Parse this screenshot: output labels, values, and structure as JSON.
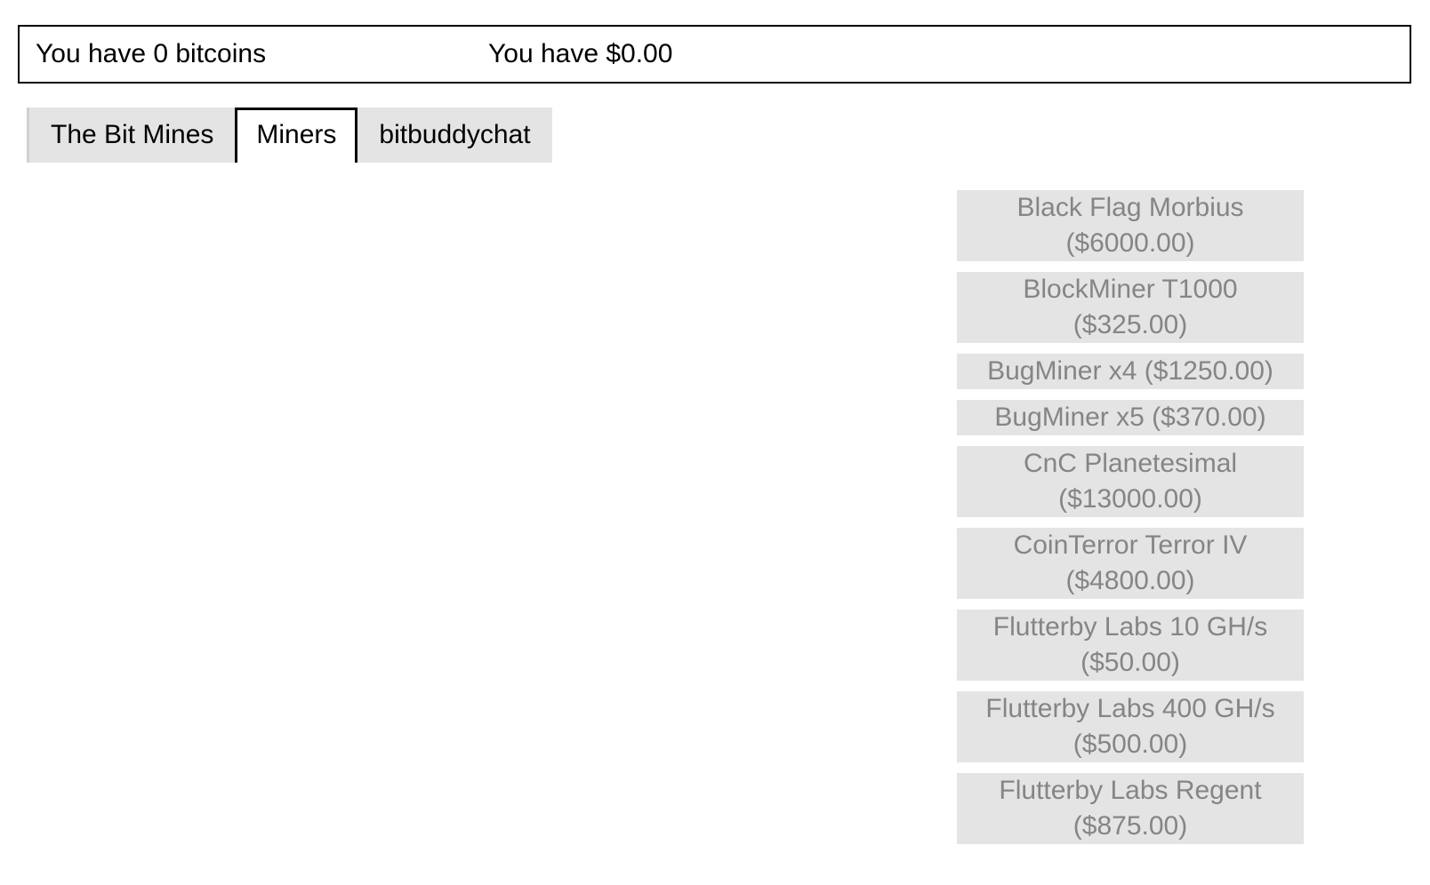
{
  "status": {
    "bitcoins_text": "You have 0 bitcoins",
    "dollars_text": "You have $0.00"
  },
  "tabs": [
    {
      "label": "The Bit Mines",
      "active": false
    },
    {
      "label": "Miners",
      "active": true
    },
    {
      "label": "bitbuddychat",
      "active": false
    }
  ],
  "miners": [
    {
      "label": "Black Flag Morbius ($6000.00)",
      "name": "Black Flag Morbius",
      "price": "$6000.00"
    },
    {
      "label": "BlockMiner T1000 ($325.00)",
      "name": "BlockMiner T1000",
      "price": "$325.00"
    },
    {
      "label": "BugMiner x4 ($1250.00)",
      "name": "BugMiner x4",
      "price": "$1250.00"
    },
    {
      "label": "BugMiner x5 ($370.00)",
      "name": "BugMiner x5",
      "price": "$370.00"
    },
    {
      "label": "CnC Planetesimal ($13000.00)",
      "name": "CnC Planetesimal",
      "price": "$13000.00"
    },
    {
      "label": "CoinTerror Terror IV ($4800.00)",
      "name": "CoinTerror Terror IV",
      "price": "$4800.00"
    },
    {
      "label": "Flutterby Labs 10 GH/s ($50.00)",
      "name": "Flutterby Labs 10 GH/s",
      "price": "$50.00"
    },
    {
      "label": "Flutterby Labs 400 GH/s ($500.00)",
      "name": "Flutterby Labs 400 GH/s",
      "price": "$500.00"
    },
    {
      "label": "Flutterby Labs Regent ($875.00)",
      "name": "Flutterby Labs Regent",
      "price": "$875.00"
    }
  ],
  "colors": {
    "button_bg": "#e4e4e4",
    "button_text": "#858585",
    "active_tab_bg": "#ffffff",
    "border": "#000000"
  }
}
